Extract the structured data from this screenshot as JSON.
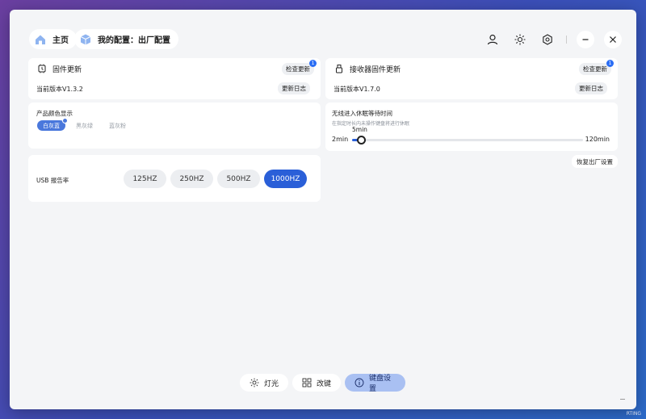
{
  "nav": {
    "home_label": "主页",
    "config_label": "我的配置：出厂配置"
  },
  "firmware": {
    "title": "固件更新",
    "check_label": "检查更新",
    "badge": "1",
    "version": "当前版本V1.3.2",
    "log_label": "更新日志"
  },
  "receiver": {
    "title": "接收器固件更新",
    "check_label": "检查更新",
    "badge": "1",
    "version": "当前版本V1.7.0",
    "log_label": "更新日志"
  },
  "color": {
    "title": "产品颜色显示",
    "options": [
      "白灰蓝",
      "黑灰绿",
      "蓝灰粉"
    ],
    "selected": "白灰蓝"
  },
  "sleep": {
    "title": "无线进入休眠等待时间",
    "subtitle": "在指定时长内未操作键盘将进行休眠",
    "current": "5min",
    "min": "2min",
    "max": "120min",
    "position_fraction": 0.026
  },
  "reset_label": "恢复出厂设置",
  "usb": {
    "label": "USB 报告率",
    "options": [
      "125HZ",
      "250HZ",
      "500HZ",
      "1000HZ"
    ],
    "selected": "1000HZ"
  },
  "bottom_nav": {
    "light": "灯光",
    "remap": "改键",
    "settings": "键盘设置"
  },
  "watermark": "RTING",
  "colors": {
    "accent": "#2a5fd8",
    "active_tab": "#a9c0f2"
  }
}
